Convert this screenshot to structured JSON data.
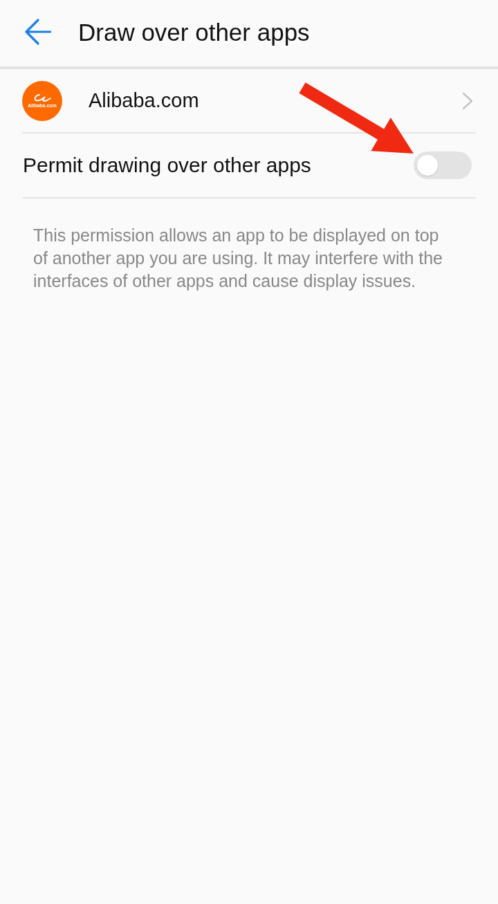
{
  "header": {
    "title": "Draw over other apps"
  },
  "app": {
    "name": "Alibaba.com",
    "logo_text": "Alibaba.com"
  },
  "settings": [
    {
      "kind": "switch",
      "label": "Permit drawing over other apps",
      "on": false
    }
  ],
  "description": "This permission allows an app to be displayed on top of another app you are using. It may interfere with the interfaces of other apps and cause display issues.",
  "annotations": [
    {
      "kind": "arrow"
    }
  ]
}
